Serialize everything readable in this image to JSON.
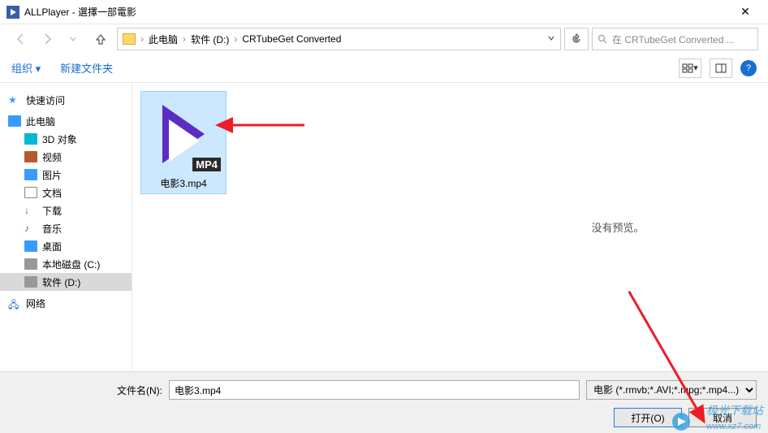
{
  "window": {
    "title": "ALLPlayer - 選擇一部電影",
    "close": "✕"
  },
  "nav": {
    "breadcrumb": {
      "pc": "此电脑",
      "drive": "软件 (D:)",
      "folder": "CRTubeGet Converted"
    },
    "search_placeholder": "在 CRTubeGet Converted ..."
  },
  "toolbar": {
    "organize": "组织 ▾",
    "newfolder": "新建文件夹",
    "help": "?"
  },
  "sidebar": {
    "quick": "快速访问",
    "pc": "此电脑",
    "items": {
      "3d": "3D 对象",
      "video": "视频",
      "pic": "图片",
      "doc": "文档",
      "download": "下载",
      "music": "音乐",
      "desktop": "桌面",
      "diskc": "本地磁盘 (C:)",
      "diskd": "软件 (D:)"
    },
    "network": "网络"
  },
  "files": {
    "selected": {
      "name": "电影3.mp4",
      "badge": "MP4"
    }
  },
  "preview": {
    "empty": "没有预览。"
  },
  "bottom": {
    "filename_label": "文件名(N):",
    "filename_value": "电影3.mp4",
    "filter": "电影 (*.rmvb;*.AVI;*.mpg;*.mp4...)",
    "open": "打开(O)",
    "cancel": "取消"
  },
  "watermark": {
    "text": "极光下载站",
    "url": "www.xz7.com"
  }
}
